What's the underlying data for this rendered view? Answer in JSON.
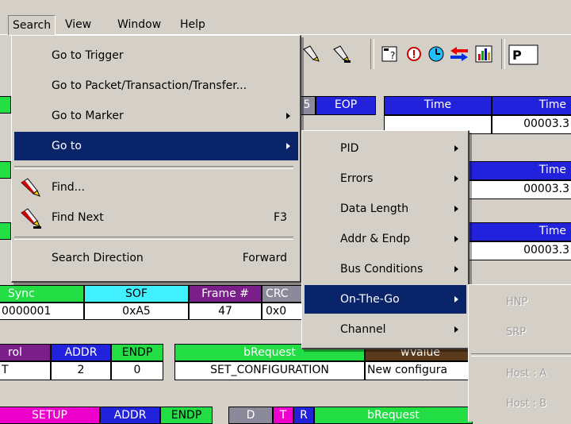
{
  "menubar": {
    "items": [
      "Search",
      "View",
      "Window",
      "Help"
    ]
  },
  "trace": {
    "rows_partial": [
      {
        "eop": "EOP",
        "time_hdr": "Time",
        "time_hdr2": "Time",
        "time2": "00003.3"
      },
      {
        "time_hdr2": "Time",
        "time2": "00003.3"
      },
      {
        "time_hdr2": "Time",
        "time2": "00003.3"
      }
    ],
    "sof_row": {
      "headers": [
        "Sync",
        "SOF",
        "Frame #",
        "CRC"
      ],
      "values": [
        "0000001",
        "0xA5",
        "47",
        "0x0"
      ]
    },
    "setup_row": {
      "headers": [
        "rol",
        "ADDR",
        "ENDP",
        "bRequest",
        "wValue"
      ],
      "values": [
        "T",
        "2",
        "0",
        "SET_CONFIGURATION",
        "New configura"
      ]
    },
    "bottom_row": {
      "headers": [
        "SETUP",
        "ADDR",
        "ENDP",
        "D",
        "T",
        "R",
        "bRequest"
      ]
    }
  },
  "search_menu": {
    "items": [
      {
        "label": "Go to Trigger"
      },
      {
        "label": "Go to Packet/Transaction/Transfer..."
      },
      {
        "label": "Go to Marker",
        "submenu": true
      },
      {
        "label": "Go to",
        "submenu": true,
        "selected": true
      },
      {
        "label": "Find...",
        "icon": "flashlight-icon"
      },
      {
        "label": "Find Next",
        "shortcut": "F3",
        "icon": "flashlight-next-icon"
      },
      {
        "label": "Search Direction",
        "value": "Forward"
      }
    ]
  },
  "goto_menu": {
    "items": [
      {
        "label": "PID"
      },
      {
        "label": "Errors"
      },
      {
        "label": "Data Length"
      },
      {
        "label": "Addr & Endp"
      },
      {
        "label": "Bus Conditions"
      },
      {
        "label": "On-The-Go",
        "selected": true
      },
      {
        "label": "Channel"
      }
    ]
  },
  "otg_menu": {
    "items": [
      "HNP",
      "SRP",
      "Host : A",
      "Host : B"
    ]
  },
  "colors": {
    "menu_highlight": "#0a246a",
    "menu_bg": "#d4d0c8",
    "green": "#22dd44",
    "blue": "#2222dd",
    "cyan": "#40f0ff",
    "purple": "#7a1e8a",
    "magenta": "#ee00cc",
    "gray": "#8a8a9a"
  }
}
